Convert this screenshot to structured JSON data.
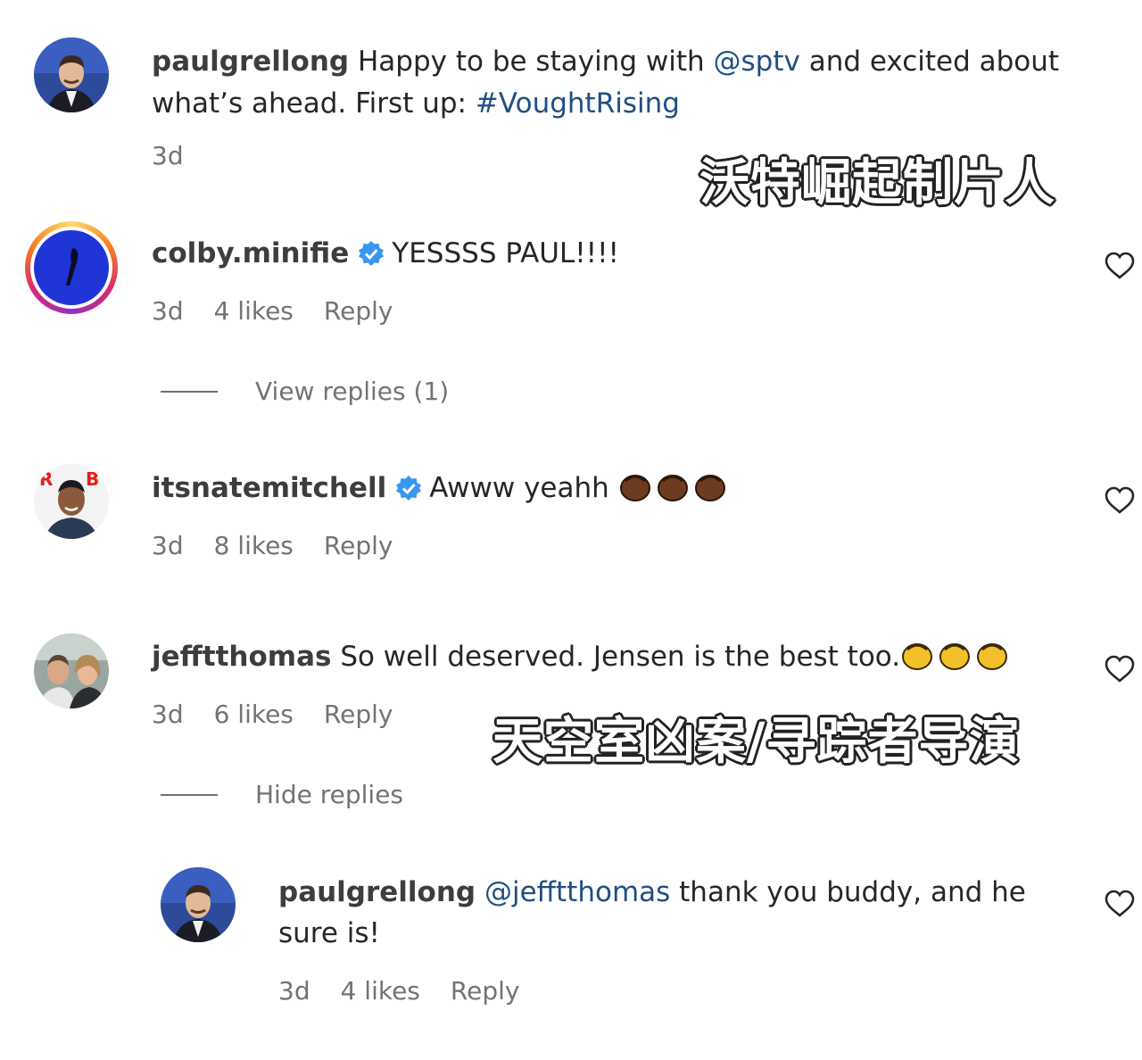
{
  "caption": {
    "username": "paulgrellong",
    "text_1": "Happy to be staying with ",
    "mention": "@sptv",
    "text_2": " and excited about",
    "text_3": "what’s ahead. First up: ",
    "hashtag": "#VoughtRising",
    "time": "3d"
  },
  "overlays": {
    "top": "沃特崛起制片人",
    "bottom": "天空室凶案/寻踪者导演"
  },
  "comments": [
    {
      "username": "colby.minifie",
      "verified": true,
      "text": "YESSSS PAUL!!!!",
      "time": "3d",
      "likes": "4 likes",
      "reply": "Reply",
      "toggle": "View replies (1)"
    },
    {
      "username": "itsnatemitchell",
      "verified": true,
      "text": "Awww yeahh ",
      "time": "3d",
      "likes": "8 likes",
      "reply": "Reply"
    },
    {
      "username": "jefftthomas",
      "verified": false,
      "text": "So well deserved. Jensen is the best too.",
      "time": "3d",
      "likes": "6 likes",
      "reply": "Reply",
      "toggle": "Hide replies"
    }
  ],
  "reply": {
    "username": "paulgrellong",
    "mention": "@jefftthomas",
    "text_1": " thank you buddy, and he",
    "text_2": "sure is!",
    "time": "3d",
    "likes": "4 likes",
    "reply": "Reply"
  },
  "colors": {
    "link": "#1f4f82",
    "verified": "#3897f0",
    "meta": "#737373"
  }
}
